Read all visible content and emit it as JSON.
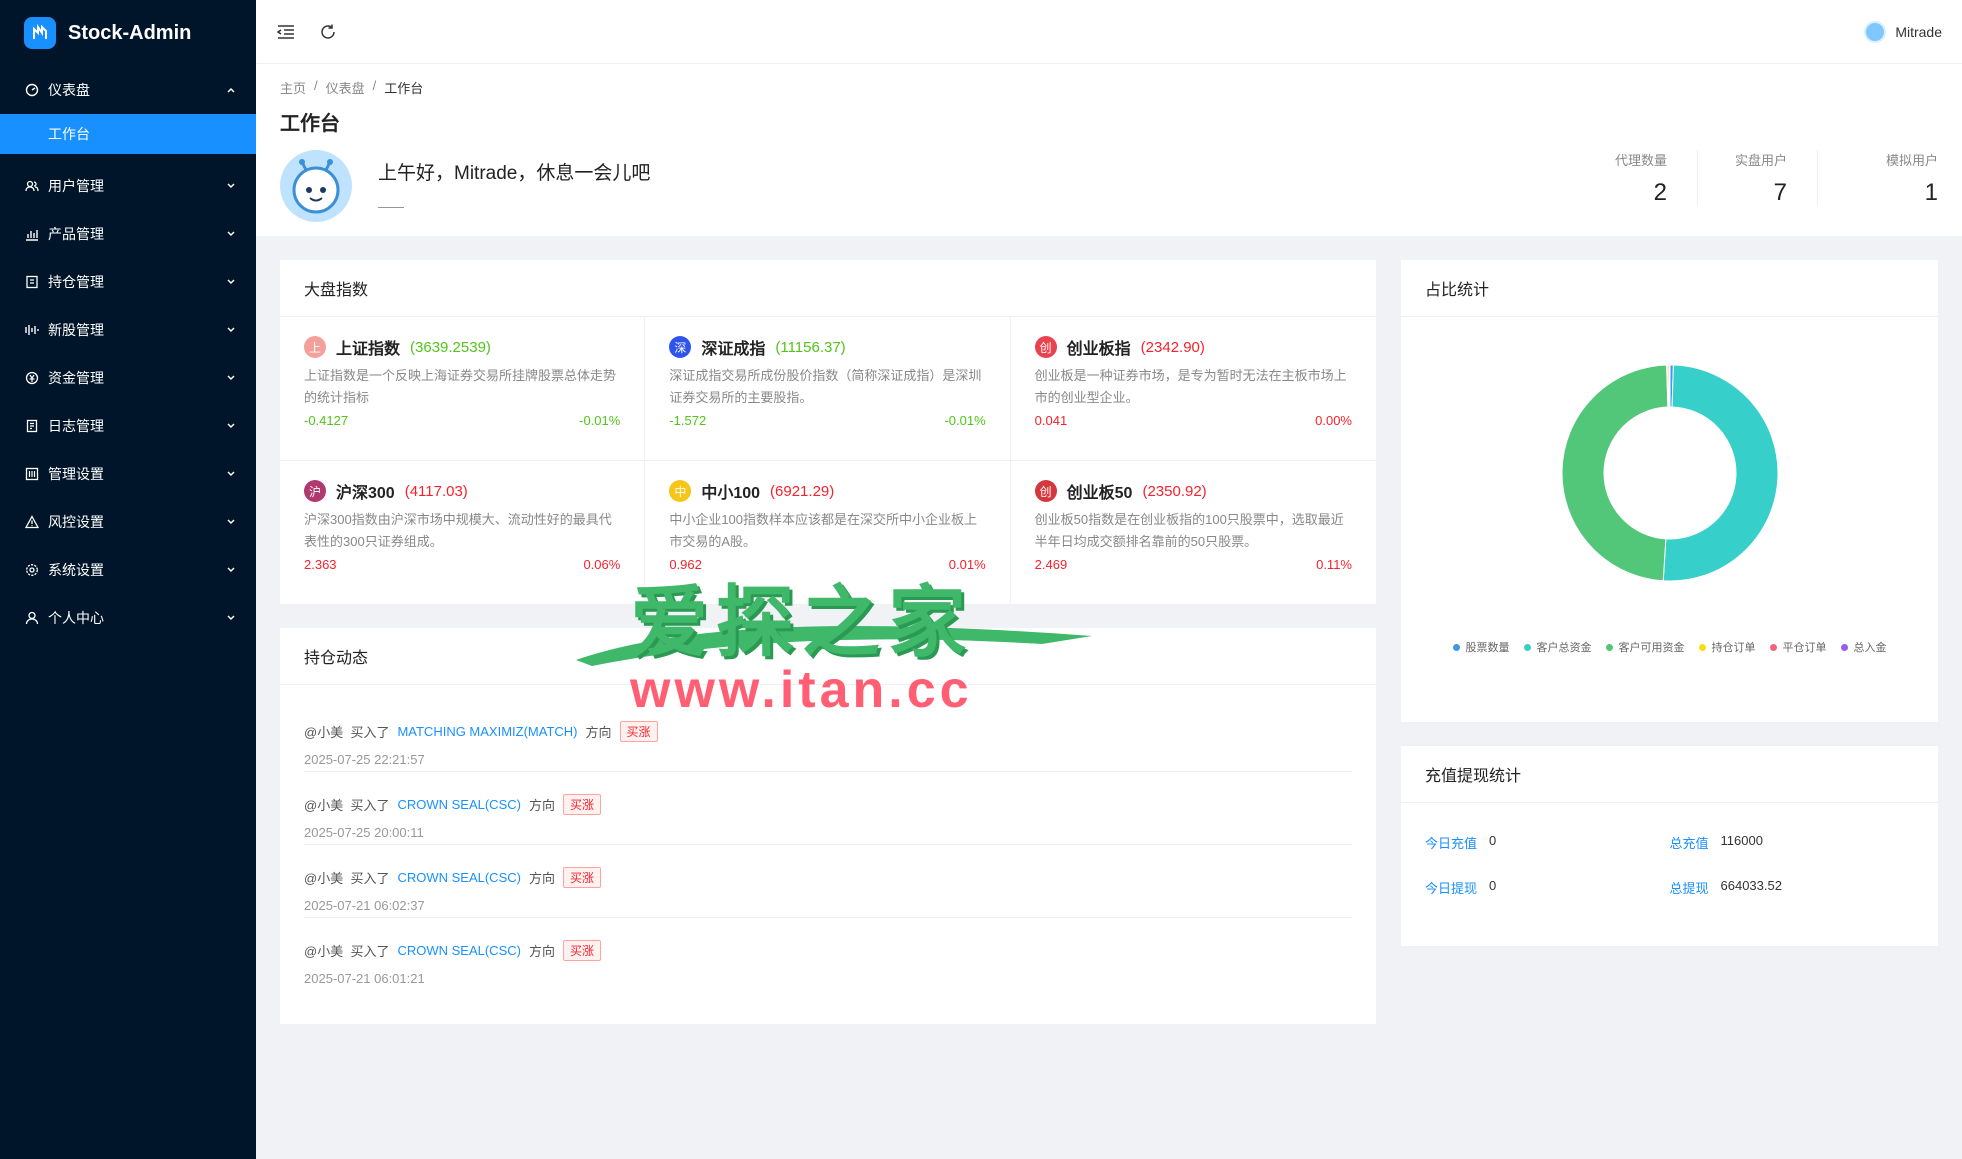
{
  "app": {
    "title": "Stock-Admin"
  },
  "sidebar": {
    "items": [
      {
        "label": "仪表盘",
        "icon": "dashboard-icon",
        "expanded": true,
        "children": [
          {
            "label": "工作台",
            "active": true
          }
        ]
      },
      {
        "label": "用户管理",
        "icon": "users-icon"
      },
      {
        "label": "产品管理",
        "icon": "chart-icon"
      },
      {
        "label": "持仓管理",
        "icon": "holding-icon"
      },
      {
        "label": "新股管理",
        "icon": "ipo-icon"
      },
      {
        "label": "资金管理",
        "icon": "money-icon"
      },
      {
        "label": "日志管理",
        "icon": "log-icon"
      },
      {
        "label": "管理设置",
        "icon": "admin-settings-icon"
      },
      {
        "label": "风控设置",
        "icon": "warning-icon"
      },
      {
        "label": "系统设置",
        "icon": "gear-icon"
      },
      {
        "label": "个人中心",
        "icon": "user-icon"
      }
    ]
  },
  "header": {
    "user_name": "Mitrade"
  },
  "breadcrumb": [
    "主页",
    "仪表盘",
    "工作台"
  ],
  "page": {
    "title": "工作台",
    "welcome": "上午好，Mitrade，休息一会儿吧",
    "welcome_sub": "——"
  },
  "stats": [
    {
      "label": "代理数量",
      "value": "2"
    },
    {
      "label": "实盘用户",
      "value": "7"
    },
    {
      "label": "模拟用户",
      "value": "1"
    }
  ],
  "market": {
    "title": "大盘指数",
    "indices": [
      {
        "badge": "上",
        "badge_color": "#f4a09a",
        "name": "上证指数",
        "value": "(3639.2539)",
        "desc": "上证指数是一个反映上海证券交易所挂牌股票总体走势的统计指标",
        "change": "-0.4127",
        "pct": "-0.01%",
        "trend": "down"
      },
      {
        "badge": "深",
        "badge_color": "#2f54eb",
        "name": "深证成指",
        "value": "(11156.37)",
        "desc": "深证成指交易所成份股价指数（简称深证成指）是深圳证券交易所的主要股指。",
        "change": "-1.572",
        "pct": "-0.01%",
        "trend": "down"
      },
      {
        "badge": "创",
        "badge_color": "#e8434f",
        "name": "创业板指",
        "value": "(2342.90)",
        "desc": "创业板是一种证券市场，是专为暂时无法在主板市场上市的创业型企业。",
        "change": "0.041",
        "pct": "0.00%",
        "trend": "up"
      },
      {
        "badge": "沪",
        "badge_color": "#b0396d",
        "name": "沪深300",
        "value": "(4117.03)",
        "desc": "沪深300指数由沪深市场中规模大、流动性好的最具代表性的300只证券组成。",
        "change": "2.363",
        "pct": "0.06%",
        "trend": "up"
      },
      {
        "badge": "中",
        "badge_color": "#f5c518",
        "name": "中小100",
        "value": "(6921.29)",
        "desc": "中小企业100指数样本应该都是在深交所中小企业板上市交易的A股。",
        "change": "0.962",
        "pct": "0.01%",
        "trend": "up"
      },
      {
        "badge": "创",
        "badge_color": "#d4383e",
        "name": "创业板50",
        "value": "(2350.92)",
        "desc": "创业板50指数是在创业板指的100只股票中，选取最近半年日均成交额排名靠前的50只股票。",
        "change": "2.469",
        "pct": "0.11%",
        "trend": "up"
      }
    ]
  },
  "holdings": {
    "title": "持仓动态",
    "items": [
      {
        "user": "@小美",
        "action": "买入了",
        "stock": "MATCHING MAXIMIZ(MATCH)",
        "dir_label": "方向",
        "tag": "买涨",
        "time": "2025-07-25 22:21:57"
      },
      {
        "user": "@小美",
        "action": "买入了",
        "stock": "CROWN SEAL(CSC)",
        "dir_label": "方向",
        "tag": "买涨",
        "time": "2025-07-25 20:00:11"
      },
      {
        "user": "@小美",
        "action": "买入了",
        "stock": "CROWN SEAL(CSC)",
        "dir_label": "方向",
        "tag": "买涨",
        "time": "2025-07-21 06:02:37"
      },
      {
        "user": "@小美",
        "action": "买入了",
        "stock": "CROWN SEAL(CSC)",
        "dir_label": "方向",
        "tag": "买涨",
        "time": "2025-07-21 06:01:21"
      }
    ]
  },
  "ratio": {
    "title": "占比统计",
    "chart_data": {
      "type": "pie",
      "categories": [
        "股票数量",
        "客户总资金",
        "客户可用资金",
        "持仓订单",
        "平仓订单",
        "总入金"
      ],
      "values": [
        0.5,
        50.5,
        48.5,
        0.2,
        0.2,
        0.1
      ],
      "colors": [
        "#3b9ae8",
        "#36cfc9",
        "#52c77a",
        "#fadb14",
        "#f2637b",
        "#975fe5"
      ],
      "legend": "bottom"
    }
  },
  "charge": {
    "title": "充值提现统计",
    "items": [
      {
        "label": "今日充值",
        "value": "0"
      },
      {
        "label": "总充值",
        "value": "116000"
      },
      {
        "label": "今日提现",
        "value": "0"
      },
      {
        "label": "总提现",
        "value": "664033.52"
      }
    ]
  },
  "watermark": {
    "line1": "爱探之家",
    "line2": "www.itan.cc"
  }
}
